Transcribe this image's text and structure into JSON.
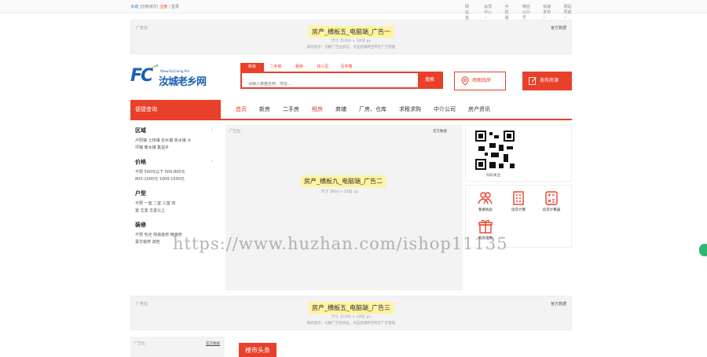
{
  "topbar": {
    "city": "汝城",
    "switch_city": "[切换城市]",
    "register": "注册",
    "sep": "/",
    "login": "登录",
    "links": [
      "网站首页",
      "会员中心 ⌵",
      "手机版",
      "微信公众号",
      "快速发布 ⌵",
      "网站导航 ⌵"
    ]
  },
  "ad1": {
    "label": "广告位:",
    "link": "官方数据",
    "title": "房产_横板五_电脑端_广告一",
    "size": "尺寸【1200 × 100】px",
    "tip": "操作提示：切换广告位状态，点击后跳转至所在广告管理"
  },
  "logo": {
    "fc": "FC",
    "www": "Www.RuCheng.Pro",
    "name": "汝城老乡网"
  },
  "search": {
    "tabs": [
      "新房",
      "二手房",
      "租房",
      "找小区",
      "写字楼"
    ],
    "placeholder": "请输入楼盘名称、地址...",
    "button": "搜索"
  },
  "header_buttons": {
    "map": "地图找房",
    "publish": "发布房源"
  },
  "nav": {
    "quick": "便捷查询",
    "items": [
      "首页",
      "新房",
      "二手房",
      "租房",
      "商铺",
      "厂房、仓库",
      "求租求购",
      "中介公司",
      "房产资讯"
    ]
  },
  "sidebar": {
    "groups": [
      {
        "title": "区域",
        "lines": [
          "卢阳镇  土桥镇  泉水镇  热水镇  大",
          "坪镇  暖水镇  集益乡"
        ]
      },
      {
        "title": "价格",
        "lines": [
          "不限    500元以下    500-800元",
          "800-1000元    1000-1500元"
        ]
      },
      {
        "title": "户型",
        "lines": [
          "不限    一室    二室    三室    四",
          "室    五室    五室以上"
        ]
      },
      {
        "title": "装修",
        "lines": [
          "不限    毛坯    简易装修    精装修",
          "豪华装修    其他"
        ]
      }
    ]
  },
  "center_ad": {
    "label": "广告位:",
    "link": "官方数据",
    "title": "房产_横板九_电脑端_广告二",
    "size": "尺寸【944 × 330】px"
  },
  "qr": {
    "caption": "扫码关注"
  },
  "tools": [
    {
      "icon": "people-icon",
      "label": "我要找房"
    },
    {
      "icon": "building-icon",
      "label": "房贷计算"
    },
    {
      "icon": "calculator-icon",
      "label": "房贷计算器"
    },
    {
      "icon": "gift-icon",
      "label": "购房优惠"
    }
  ],
  "ad3": {
    "label": "广告位:",
    "link": "官方数据",
    "title": "房产_横板五_电脑端_广告三",
    "size": "尺寸【1200 × 100】px",
    "tip": "操作提示：切换广告位状态，点击后跳转至所在广告管理"
  },
  "bottom_ad": {
    "label": "广告位:",
    "link": "官方数据"
  },
  "news_header": "楼市头条",
  "watermark": "https://www.huzhan.com/ishop11135",
  "colors": {
    "accent": "#e8402a",
    "brand_blue": "#1a5fb4",
    "ad_bg": "#f3f3f3"
  }
}
